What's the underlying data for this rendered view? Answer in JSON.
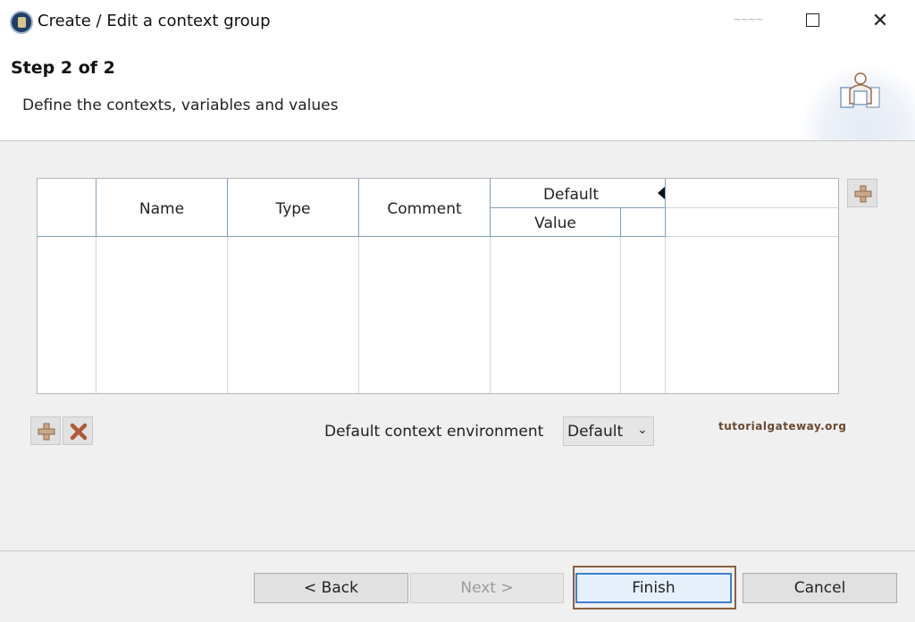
{
  "window": {
    "title": "Create / Edit a context group",
    "minimize_glyph": "~~~~",
    "close_glyph": "✕"
  },
  "header": {
    "step_title": "Step 2 of 2",
    "description": "Define the contexts, variables and values",
    "icon": "wizard-users-icon"
  },
  "table": {
    "columns": {
      "name": "Name",
      "type": "Type",
      "comment": "Comment",
      "context_group": "Default",
      "value": "Value"
    },
    "rows": []
  },
  "environment": {
    "label": "Default context environment",
    "selected": "Default"
  },
  "watermark": "tutorialgateway.org",
  "buttons": {
    "back": "< Back",
    "next": "Next >",
    "finish": "Finish",
    "cancel": "Cancel"
  },
  "colors": {
    "accent_border": "#3c7fcf",
    "highlight_frame": "#8a6042",
    "header_line": "#7d9ec2",
    "add_icon": "#c9a98a",
    "remove_icon": "#b05a3a"
  }
}
